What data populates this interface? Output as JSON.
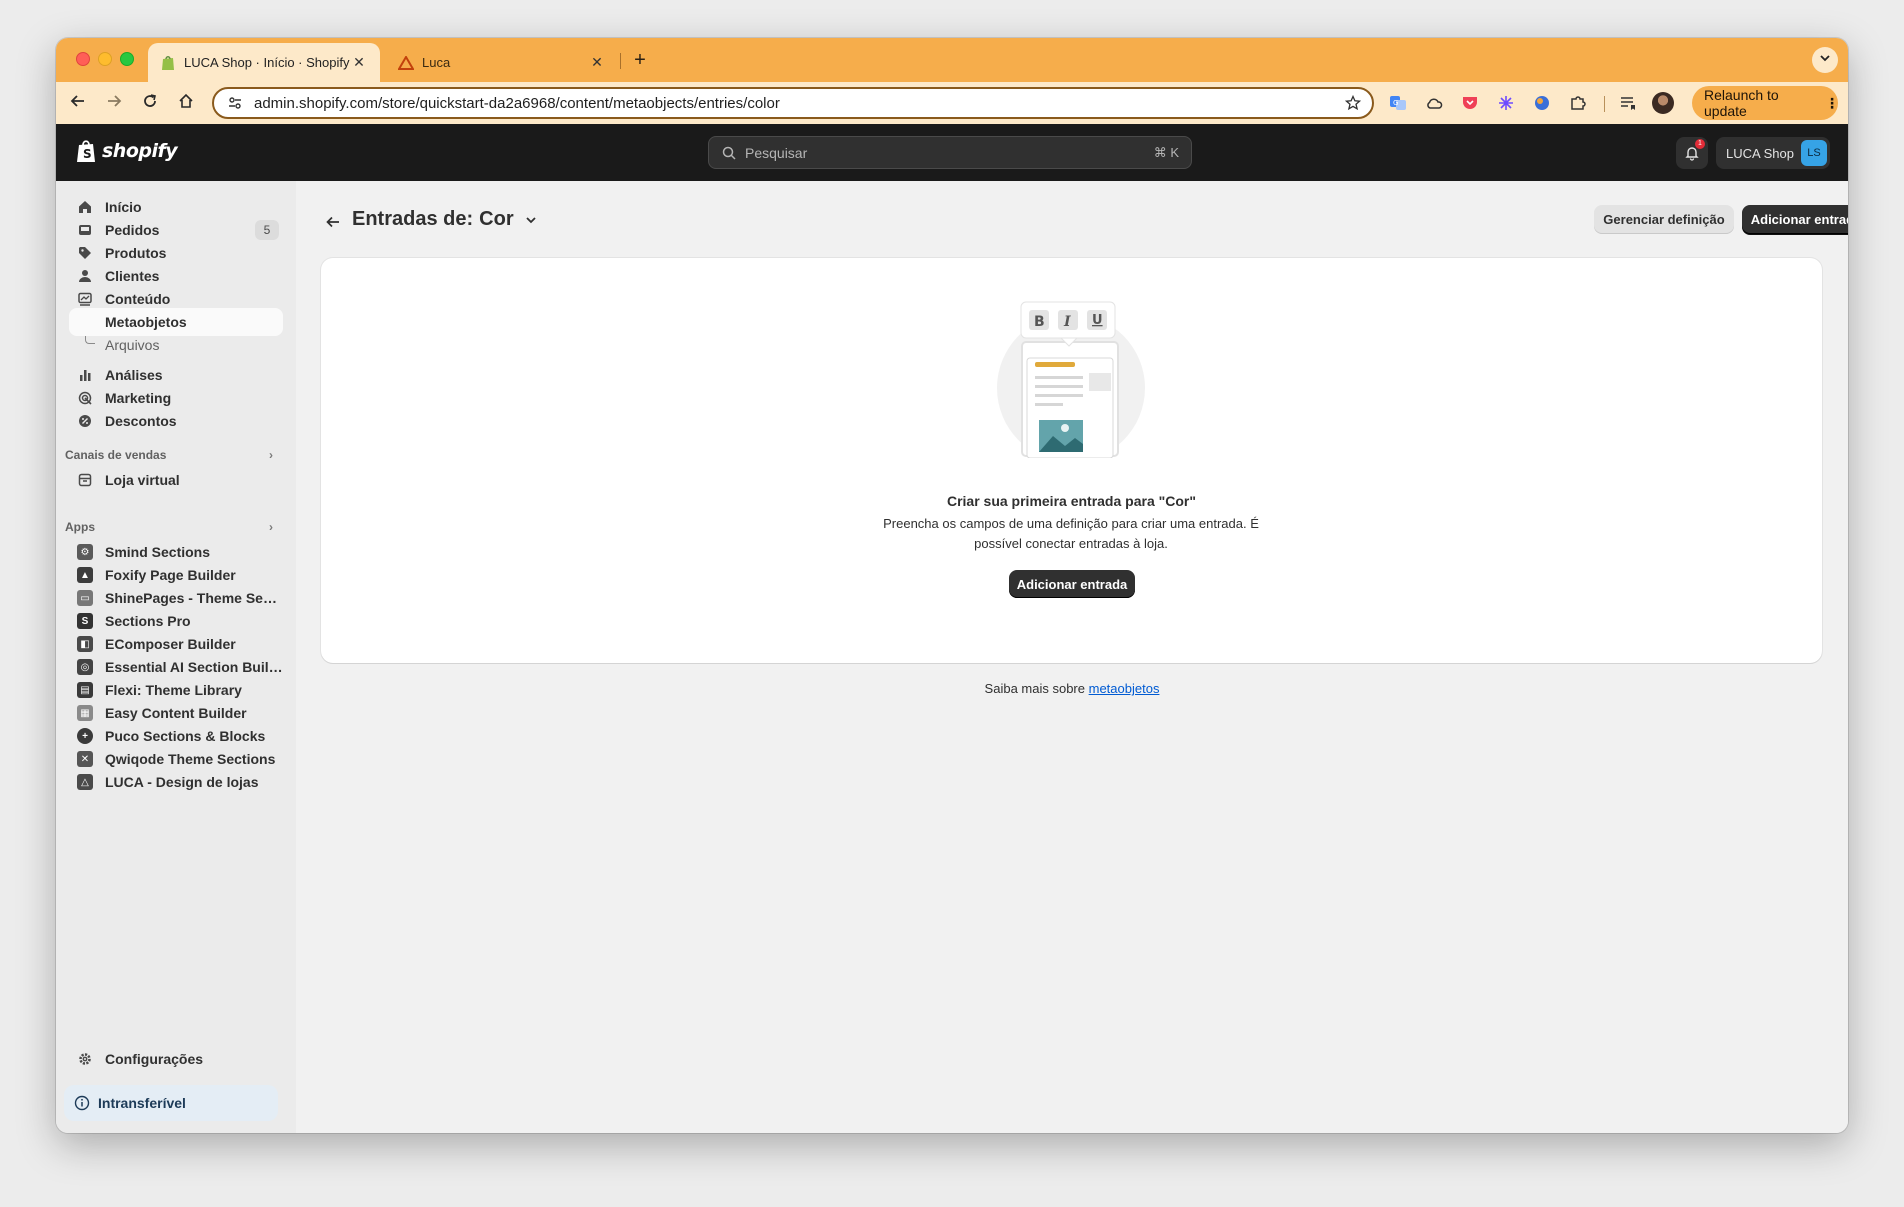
{
  "browser": {
    "tabs": [
      {
        "title": "LUCA Shop · Início · Shopify",
        "close": "✕"
      },
      {
        "title": "Luca",
        "close": "✕"
      }
    ],
    "new_tab": "+",
    "url": "admin.shopify.com/store/quickstart-da2a6968/content/metaobjects/entries/color",
    "relaunch_label": "Relaunch to update",
    "relaunch_menu": "⋮",
    "toolbar_color": "#f6ad4b"
  },
  "topbar": {
    "brand": "shopify",
    "search_placeholder": "Pesquisar",
    "search_shortcut": "⌘ K",
    "notification_count": "1",
    "store_name": "LUCA Shop",
    "store_initials": "LS"
  },
  "sidebar": {
    "items": [
      {
        "label": "Início",
        "icon": "home-icon"
      },
      {
        "label": "Pedidos",
        "icon": "orders-icon",
        "count": "5"
      },
      {
        "label": "Produtos",
        "icon": "tag-icon"
      },
      {
        "label": "Clientes",
        "icon": "person-icon"
      },
      {
        "label": "Conteúdo",
        "icon": "content-icon"
      }
    ],
    "sub_items": [
      {
        "label": "Metaobjetos"
      },
      {
        "label": "Arquivos"
      }
    ],
    "items2": [
      {
        "label": "Análises",
        "icon": "chart-icon"
      },
      {
        "label": "Marketing",
        "icon": "target-icon"
      },
      {
        "label": "Descontos",
        "icon": "discount-icon"
      }
    ],
    "sales_channels_heading": "Canais de vendas",
    "sales_channels": [
      {
        "label": "Loja virtual",
        "icon": "store-icon"
      }
    ],
    "apps_heading": "Apps",
    "apps": [
      {
        "label": "Smind Sections",
        "icon": "smind-app-icon"
      },
      {
        "label": "Foxify Page Builder",
        "icon": "foxify-app-icon"
      },
      {
        "label": "ShinePages - Theme Sect...",
        "icon": "shinepages-app-icon"
      },
      {
        "label": "Sections Pro",
        "icon": "sections-pro-app-icon",
        "glyph": "S"
      },
      {
        "label": "EComposer Builder",
        "icon": "ecomposer-app-icon"
      },
      {
        "label": "Essential AI Section Builder",
        "icon": "essential-app-icon"
      },
      {
        "label": "Flexi: Theme Library",
        "icon": "flexi-app-icon"
      },
      {
        "label": "Easy Content Builder",
        "icon": "easy-content-app-icon"
      },
      {
        "label": "Puco Sections & Blocks",
        "icon": "puco-app-icon"
      },
      {
        "label": "Qwiqode Theme Sections",
        "icon": "qwiqode-app-icon"
      },
      {
        "label": "LUCA - Design de lojas",
        "icon": "luca-app-icon"
      }
    ],
    "settings_label": "Configurações",
    "transfer_label": "Intransferível"
  },
  "main": {
    "title_prefix": "Entradas de:",
    "title_type": "Cor",
    "manage_label": "Gerenciar definição",
    "add_label": "Adicionar entrada",
    "empty_title": "Criar sua primeira entrada para \"Cor\"",
    "empty_desc": "Preencha os campos de uma definição para criar uma entrada. É possível conectar entradas à loja.",
    "empty_button": "Adicionar entrada",
    "help_prefix": "Saiba mais sobre",
    "help_link": "metaobjetos",
    "editor_icons": [
      "B",
      "I",
      "U"
    ]
  }
}
